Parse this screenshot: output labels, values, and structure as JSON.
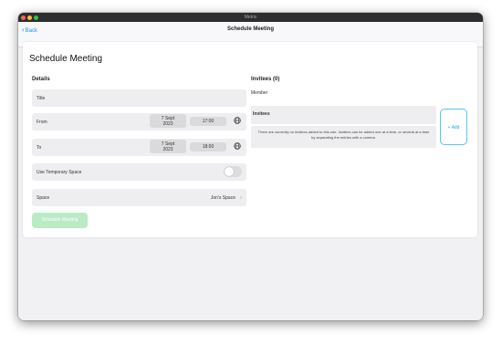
{
  "window": {
    "title": "Metrix"
  },
  "navbar": {
    "back_label": "Back",
    "title": "Schedule Meeting"
  },
  "form": {
    "heading": "Schedule Meeting",
    "details_label": "Details",
    "title_placeholder": "Title",
    "from": {
      "label": "From",
      "date_line1": "7 Sept",
      "date_line2": "2023",
      "time": "17:00"
    },
    "to": {
      "label": "To",
      "date_line1": "7 Sept",
      "date_line2": "2023",
      "time": "18:00"
    },
    "temporary_space": {
      "label": "Use Temporary Space",
      "enabled": false
    },
    "space": {
      "label": "Space",
      "value": "Jon's Space"
    },
    "submit_label": "Schedule Meeting"
  },
  "invitees": {
    "header": "Invitees (0)",
    "member_label": "Member",
    "invitees_label": "Invitees",
    "empty_note": "There are currently no invitees added to this role. Invitees can be added one at a time, or several at a time by separating the entries with a comma.",
    "add_label": "Add",
    "add_icon": "+"
  },
  "colors": {
    "accent": "#1596f0",
    "submit_disabled": "#b9ebc5",
    "add_border": "#5cc3ec"
  }
}
